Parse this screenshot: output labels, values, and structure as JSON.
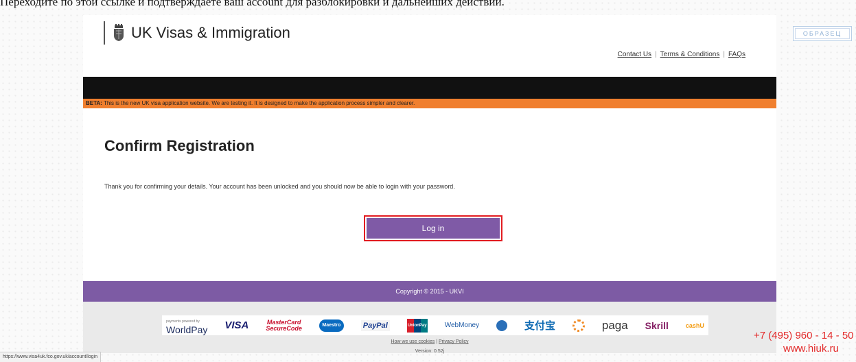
{
  "caption": "Переходите по этой ссылке и подтверждаете ваш account для разблокировки и дальнейших действий.",
  "stamp": "ОБРАЗЕЦ",
  "header": {
    "logo_text": "UK Visas & Immigration",
    "links": [
      "Contact Us",
      "Terms & Conditions",
      "FAQs"
    ]
  },
  "beta": {
    "label": "BETA:",
    "text": " This is the new UK visa application website. We are testing it. It is designed to make the application process simpler and clearer."
  },
  "main": {
    "title": "Confirm Registration",
    "message": "Thank you for confirming your details. Your account has been unlocked and you should now be able to login with your password.",
    "login_button": "Log in"
  },
  "footer": {
    "copyright": "Copyright © 2015 - UKVI",
    "payment_logos": {
      "worldpay_small": "payments powered by",
      "worldpay": "WorldPay",
      "visa": "VISA",
      "mastercard_1": "MasterCard",
      "mastercard_2": "SecureCode",
      "maestro": "Maestro",
      "paypal": "PayPal",
      "unionpay": "UnionPay",
      "webmoney": "WebMoney",
      "alipay": "支付宝",
      "paga": "paga",
      "skrill": "Skrill",
      "cashu": "cashU"
    },
    "cookies_link": "How we use cookies",
    "privacy_link": "Privacy Policy",
    "version": "Version: 0.52j"
  },
  "watermark": {
    "phone": "+7 (495) 960 - 14 - 50",
    "site": "www.hiuk.ru"
  },
  "status_url": "https://www.visa4uk.fco.gov.uk/account/login",
  "colors": {
    "beta_orange": "#f07f2e",
    "purple": "#7d5ba4",
    "highlight_red": "#e21c21"
  }
}
